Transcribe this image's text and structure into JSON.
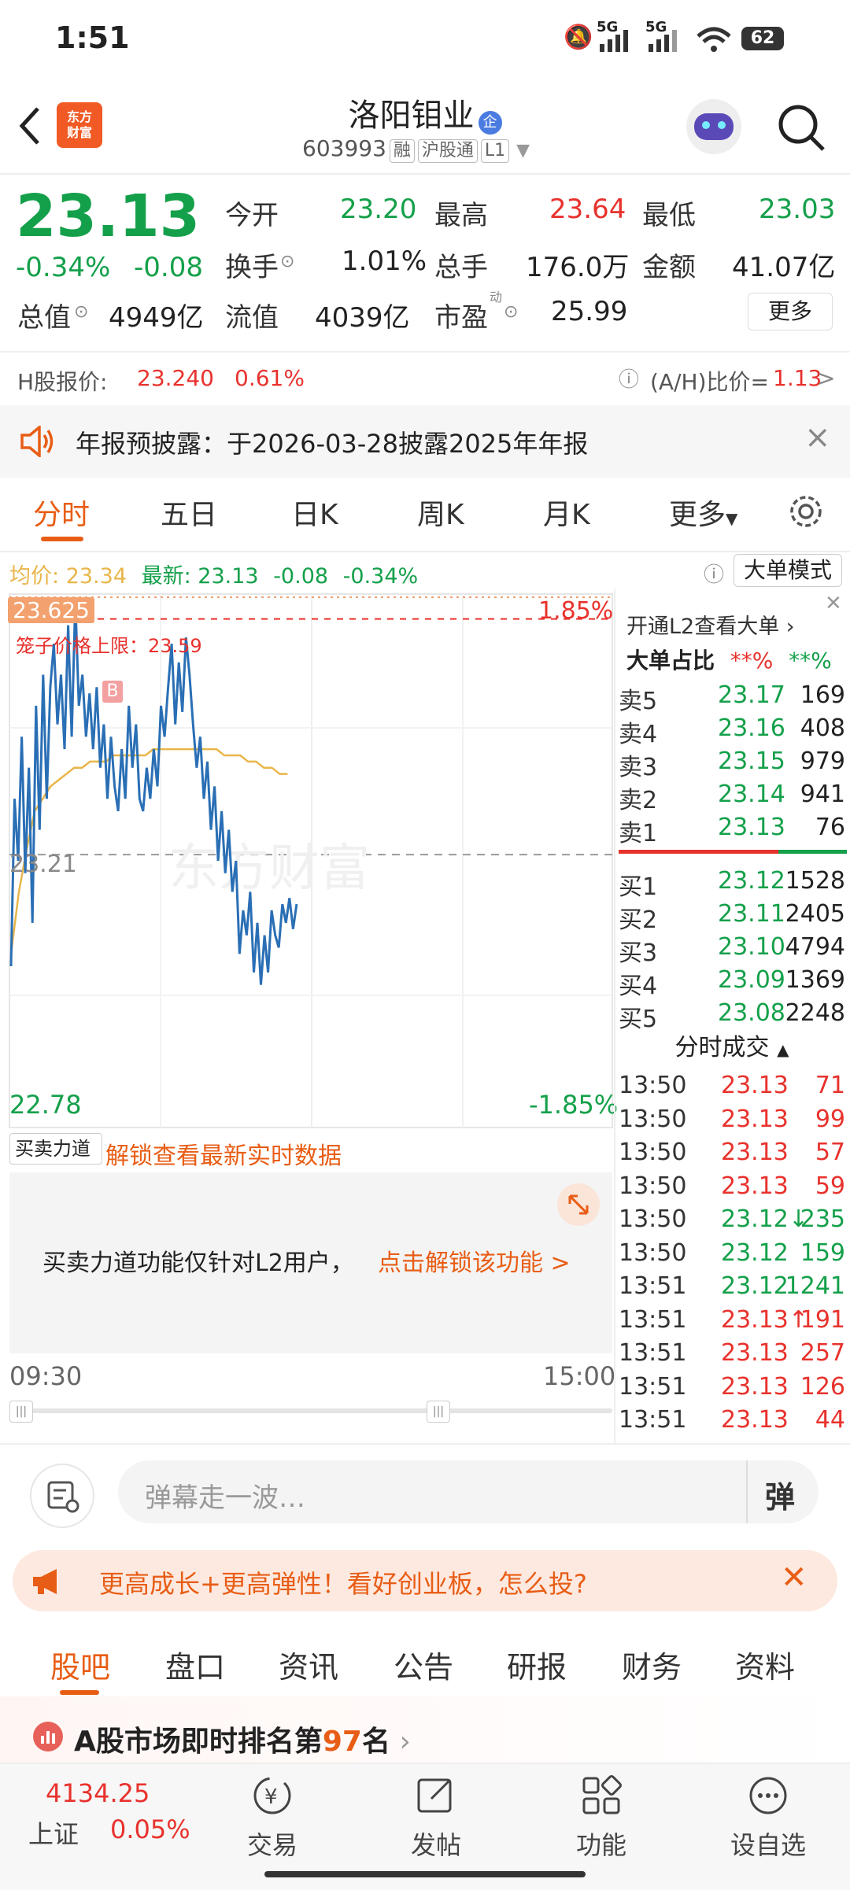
{
  "status_bar": {
    "time": "1:51",
    "battery": "62",
    "net1": "5G",
    "net2": "5G"
  },
  "header": {
    "logo_line1": "东方",
    "logo_line2": "财富",
    "title": "洛阳钼业",
    "title_badge": "企",
    "code": "603993",
    "tags": [
      "融",
      "沪股通",
      "L1"
    ]
  },
  "quote": {
    "price": "23.13",
    "change_pct": "-0.34%",
    "change": "-0.08",
    "stats": [
      {
        "label": "今开",
        "value": "23.20"
      },
      {
        "label": "最高",
        "value": "23.64"
      },
      {
        "label": "最低",
        "value": "23.03"
      },
      {
        "label": "换手",
        "value": "1.01%"
      },
      {
        "label": "总手",
        "value": "176.0万"
      },
      {
        "label": "金额",
        "value": "41.07亿"
      },
      {
        "label": "总值",
        "value": "4949亿"
      },
      {
        "label": "流值",
        "value": "4039亿"
      },
      {
        "label": "市盈",
        "value": "25.99"
      }
    ],
    "pe_sup": "动",
    "more_button": "更多",
    "h_label": "H股报价:",
    "h_price": "23.240",
    "h_pct": "0.61%",
    "ah_label": "(A/H)比价=",
    "ah_value": "1.13",
    "ah_arrow": ">"
  },
  "notice": {
    "text": "年报预披露：于2026-03-28披露2025年年报",
    "close": "×"
  },
  "tabs": [
    "分时",
    "五日",
    "日K",
    "周K",
    "月K",
    "更多"
  ],
  "chart_info": {
    "avg_label": "均价:",
    "avg_value": "23.34",
    "latest_label": "最新:",
    "latest_value": "23.13",
    "latest_change": "-0.08",
    "latest_pct": "-0.34%",
    "big_mode": "大单模式"
  },
  "chart_data": {
    "type": "line",
    "y_max_label": "23.625",
    "y_mid_label": "23.21",
    "y_min_label": "22.78",
    "pct_max": "1.85%",
    "pct_min": "-1.85%",
    "cage_label": "笼子价格上限：23.59",
    "marker": "B",
    "watermark": "东方财富",
    "ylim": [
      22.78,
      23.625
    ],
    "prev_close": 23.21,
    "x_start": "09:30",
    "x_end": "15:00",
    "series": [
      {
        "values": [
          23.03,
          23.3,
          23.2,
          23.4,
          23.18,
          23.35,
          23.1,
          23.45,
          23.25,
          23.5,
          23.3,
          23.48,
          23.55,
          23.42,
          23.5,
          23.38,
          23.58,
          23.4,
          23.62,
          23.45,
          23.5,
          23.4,
          23.47,
          23.38,
          23.48,
          23.35,
          23.42,
          23.3,
          23.4,
          23.32,
          23.28,
          23.38,
          23.3,
          23.45,
          23.35,
          23.42,
          23.3,
          23.28,
          23.35,
          23.3,
          23.38,
          23.32,
          23.45,
          23.4,
          23.48,
          23.55,
          23.42,
          23.52,
          23.44,
          23.56,
          23.5,
          23.42,
          23.35,
          23.4,
          23.3,
          23.36,
          23.25,
          23.32,
          23.2,
          23.28,
          23.18,
          23.25,
          23.15,
          23.2,
          23.05,
          23.12,
          23.08,
          23.15,
          23.02,
          23.1,
          23.0,
          23.08,
          23.02,
          23.12,
          23.08,
          23.06,
          23.13,
          23.1,
          23.14,
          23.09,
          23.13
        ]
      },
      {
        "values": [
          23.05,
          23.15,
          23.22,
          23.28,
          23.3,
          23.32,
          23.33,
          23.34,
          23.35,
          23.35,
          23.36,
          23.36,
          23.36,
          23.37,
          23.37,
          23.37,
          23.37,
          23.37,
          23.38,
          23.38,
          23.38,
          23.38,
          23.38,
          23.38,
          23.38,
          23.38,
          23.38,
          23.37,
          23.37,
          23.37,
          23.36,
          23.36,
          23.35,
          23.35,
          23.34,
          23.34
        ]
      }
    ]
  },
  "order_book": {
    "promo": "开通L2查看大单 ›",
    "big_ratio_label": "大单占比",
    "ratio1": "**%",
    "ratio2": "**%",
    "asks": [
      {
        "label": "卖5",
        "price": "23.17",
        "vol": "169"
      },
      {
        "label": "卖4",
        "price": "23.16",
        "vol": "408"
      },
      {
        "label": "卖3",
        "price": "23.15",
        "vol": "979"
      },
      {
        "label": "卖2",
        "price": "23.14",
        "vol": "941"
      },
      {
        "label": "卖1",
        "price": "23.13",
        "vol": "76"
      }
    ],
    "bids": [
      {
        "label": "买1",
        "price": "23.12",
        "vol": "1528"
      },
      {
        "label": "买2",
        "price": "23.11",
        "vol": "2405"
      },
      {
        "label": "买3",
        "price": "23.10",
        "vol": "4794"
      },
      {
        "label": "买4",
        "price": "23.09",
        "vol": "1369"
      },
      {
        "label": "买5",
        "price": "23.08",
        "vol": "2248"
      }
    ],
    "trades_title": "分时成交",
    "trades": [
      {
        "time": "13:50",
        "price": "23.13",
        "vol": "71",
        "color": "red"
      },
      {
        "time": "13:50",
        "price": "23.13",
        "vol": "99",
        "color": "red"
      },
      {
        "time": "13:50",
        "price": "23.13",
        "vol": "57",
        "color": "red"
      },
      {
        "time": "13:50",
        "price": "23.13",
        "vol": "59",
        "color": "red"
      },
      {
        "time": "13:50",
        "price": "23.12↓",
        "vol": "235",
        "color": "green"
      },
      {
        "time": "13:50",
        "price": "23.12",
        "vol": "159",
        "color": "green"
      },
      {
        "time": "13:51",
        "price": "23.12",
        "vol": "1241",
        "color": "green"
      },
      {
        "time": "13:51",
        "price": "23.13↑",
        "vol": "191",
        "color": "red"
      },
      {
        "time": "13:51",
        "price": "23.13",
        "vol": "257",
        "color": "red"
      },
      {
        "time": "13:51",
        "price": "23.13",
        "vol": "126",
        "color": "red"
      },
      {
        "time": "13:51",
        "price": "23.13",
        "vol": "44",
        "color": "red"
      }
    ]
  },
  "force": {
    "selector": "买卖力道",
    "unlock": "解锁查看最新实时数据",
    "overlay_text": "买卖力道功能仅针对L2用户，",
    "overlay_link": "点击解锁该功能 >"
  },
  "danmu": {
    "placeholder": "弹幕走一波…",
    "button": "弹"
  },
  "promo_banner": {
    "text": "更高成长+更高弹性！看好创业板，怎么投?"
  },
  "bottom_tabs": [
    "股吧",
    "盘口",
    "资讯",
    "公告",
    "研报",
    "财务",
    "资料"
  ],
  "ranking": {
    "prefix": "A股市场即时排名第",
    "rank": "97",
    "suffix": "名"
  },
  "nav": {
    "index_value": "4134.25",
    "index_name": "上证",
    "index_pct": "0.05%",
    "items": [
      "交易",
      "发帖",
      "功能",
      "设自选"
    ]
  },
  "colors": {
    "red": "#e8322d",
    "green": "#14a04a",
    "orange": "#e85d15",
    "price_line": "#2a6fb5",
    "avg_line": "#e8b64a"
  }
}
